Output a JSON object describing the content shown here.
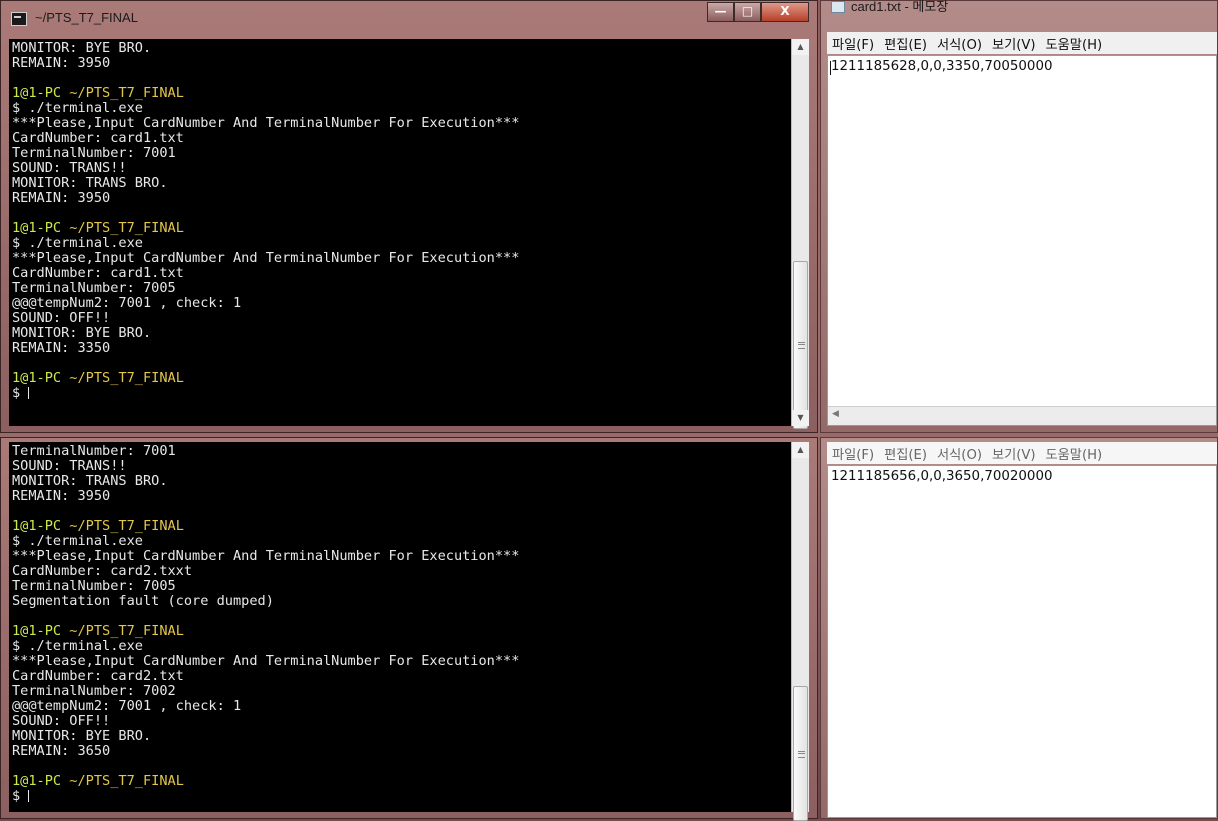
{
  "terminal_top": {
    "title": "~/PTS_T7_FINAL",
    "buttons": {
      "minimize": "—",
      "maximize": "□",
      "close": "X"
    },
    "lines": [
      {
        "type": "out",
        "text": "MONITOR: BYE BRO."
      },
      {
        "type": "out",
        "text": "REMAIN: 3950"
      },
      {
        "type": "blank",
        "text": ""
      },
      {
        "type": "prompt",
        "user": "1@1-PC",
        "path": "~/PTS_T7_FINAL"
      },
      {
        "type": "out",
        "text": "$ ./terminal.exe"
      },
      {
        "type": "out",
        "text": "***Please,Input CardNumber And TerminalNumber For Execution***"
      },
      {
        "type": "out",
        "text": "CardNumber: card1.txt"
      },
      {
        "type": "out",
        "text": "TerminalNumber: 7001"
      },
      {
        "type": "out",
        "text": "SOUND: TRANS!!"
      },
      {
        "type": "out",
        "text": "MONITOR: TRANS BRO."
      },
      {
        "type": "out",
        "text": "REMAIN: 3950"
      },
      {
        "type": "blank",
        "text": ""
      },
      {
        "type": "prompt",
        "user": "1@1-PC",
        "path": "~/PTS_T7_FINAL"
      },
      {
        "type": "out",
        "text": "$ ./terminal.exe"
      },
      {
        "type": "out",
        "text": "***Please,Input CardNumber And TerminalNumber For Execution***"
      },
      {
        "type": "out",
        "text": "CardNumber: card1.txt"
      },
      {
        "type": "out",
        "text": "TerminalNumber: 7005"
      },
      {
        "type": "out",
        "text": "@@@tempNum2: 7001 , check: 1"
      },
      {
        "type": "out",
        "text": "SOUND: OFF!!"
      },
      {
        "type": "out",
        "text": "MONITOR: BYE BRO."
      },
      {
        "type": "out",
        "text": "REMAIN: 3350"
      },
      {
        "type": "blank",
        "text": ""
      },
      {
        "type": "prompt",
        "user": "1@1-PC",
        "path": "~/PTS_T7_FINAL"
      },
      {
        "type": "input",
        "text": "$ "
      }
    ]
  },
  "terminal_bottom": {
    "lines": [
      {
        "type": "out",
        "text": "TerminalNumber: 7001"
      },
      {
        "type": "out",
        "text": "SOUND: TRANS!!"
      },
      {
        "type": "out",
        "text": "MONITOR: TRANS BRO."
      },
      {
        "type": "out",
        "text": "REMAIN: 3950"
      },
      {
        "type": "blank",
        "text": ""
      },
      {
        "type": "prompt",
        "user": "1@1-PC",
        "path": "~/PTS_T7_FINAL"
      },
      {
        "type": "out",
        "text": "$ ./terminal.exe"
      },
      {
        "type": "out",
        "text": "***Please,Input CardNumber And TerminalNumber For Execution***"
      },
      {
        "type": "out",
        "text": "CardNumber: card2.txxt"
      },
      {
        "type": "out",
        "text": "TerminalNumber: 7005"
      },
      {
        "type": "out",
        "text": "Segmentation fault (core dumped)"
      },
      {
        "type": "blank",
        "text": ""
      },
      {
        "type": "prompt",
        "user": "1@1-PC",
        "path": "~/PTS_T7_FINAL"
      },
      {
        "type": "out",
        "text": "$ ./terminal.exe"
      },
      {
        "type": "out",
        "text": "***Please,Input CardNumber And TerminalNumber For Execution***"
      },
      {
        "type": "out",
        "text": "CardNumber: card2.txt"
      },
      {
        "type": "out",
        "text": "TerminalNumber: 7002"
      },
      {
        "type": "out",
        "text": "@@@tempNum2: 7001 , check: 1"
      },
      {
        "type": "out",
        "text": "SOUND: OFF!!"
      },
      {
        "type": "out",
        "text": "MONITOR: BYE BRO."
      },
      {
        "type": "out",
        "text": "REMAIN: 3650"
      },
      {
        "type": "blank",
        "text": ""
      },
      {
        "type": "prompt",
        "user": "1@1-PC",
        "path": "~/PTS_T7_FINAL"
      },
      {
        "type": "input",
        "text": "$ "
      }
    ]
  },
  "notepad_top": {
    "title": "card1.txt - 메모장",
    "menu": [
      "파일(F)",
      "편집(E)",
      "서식(O)",
      "보기(V)",
      "도움말(H)"
    ],
    "content": "1211185628,0,0,3350,70050000"
  },
  "notepad_bottom": {
    "menu": [
      "파일(F)",
      "편집(E)",
      "서식(O)",
      "보기(V)",
      "도움말(H)"
    ],
    "content": "1211185656,0,0,3650,70020000"
  },
  "colors": {
    "console_bg": "#000000",
    "console_text": "#e8e8e8",
    "prompt_user": "#cde84a",
    "prompt_path": "#e3c64a",
    "close_button": "#b5402a"
  },
  "icons": [
    "terminal-app-icon",
    "notepad-app-icon",
    "scroll-up-arrow-icon",
    "scroll-down-arrow-icon",
    "scroll-left-arrow-icon"
  ]
}
